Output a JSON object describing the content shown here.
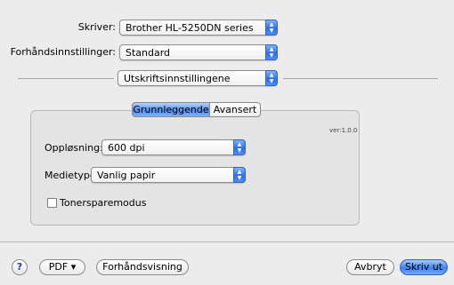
{
  "printer": {
    "label": "Skriver:",
    "value": "Brother HL-5250DN series"
  },
  "presets": {
    "label": "Forhåndsinnstillinger:",
    "value": "Standard"
  },
  "section": {
    "value": "Utskriftsinnstillingene"
  },
  "tabs": [
    {
      "label": "Grunnleggende",
      "selected": true
    },
    {
      "label": "Avansert",
      "selected": false
    }
  ],
  "version": "ver:1.0.0",
  "resolution": {
    "label": "Oppløsning:",
    "value": "600 dpi"
  },
  "media_type": {
    "label": "Medietype:",
    "value": "Vanlig papir"
  },
  "toner_save": {
    "label": "Tonersparemodus",
    "checked": false
  },
  "footer": {
    "help": "?",
    "pdf": "PDF ▾",
    "preview": "Forhåndsvisning",
    "cancel": "Avbryt",
    "print": "Skriv ut"
  },
  "icons": {
    "popup_arrows": "updown-arrows-icon",
    "help": "question-mark-icon"
  },
  "colors": {
    "accent": "#3f82ef",
    "background": "#ececec"
  }
}
